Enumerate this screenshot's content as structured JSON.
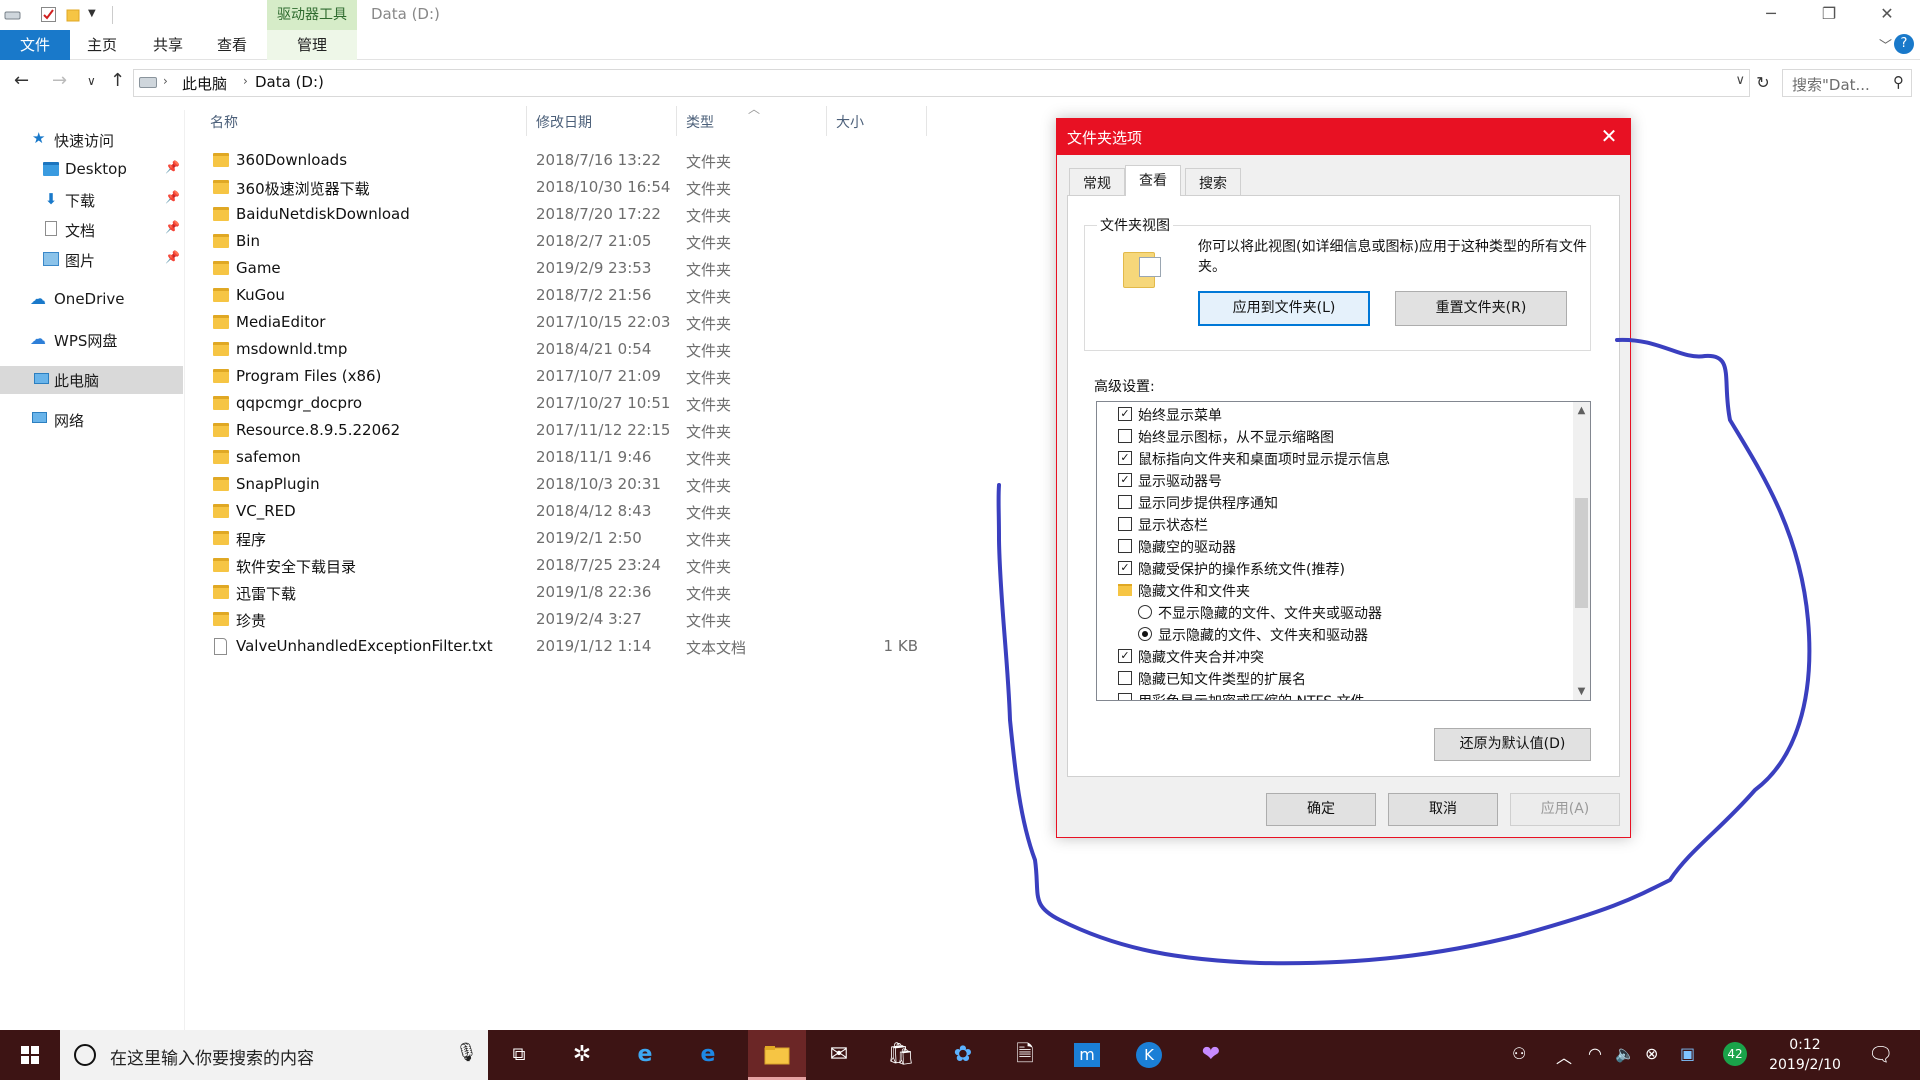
{
  "window": {
    "context_tab_group": "驱动器工具",
    "title": "Data (D:)",
    "ribbon_tabs": [
      "文件",
      "主页",
      "共享",
      "查看",
      "管理"
    ],
    "minimize": "─",
    "maximize": "❐",
    "close": "✕"
  },
  "address": {
    "segments": [
      "此电脑",
      "Data (D:)"
    ],
    "search_placeholder": "搜索\"Dat..."
  },
  "nav": {
    "quick_access": "快速访问",
    "quick_items": [
      "Desktop",
      "下载",
      "文档",
      "图片"
    ],
    "onedrive": "OneDrive",
    "wps": "WPS网盘",
    "this_pc": "此电脑",
    "network": "网络"
  },
  "columns": [
    "名称",
    "修改日期",
    "类型",
    "大小"
  ],
  "files": [
    {
      "name": "360Downloads",
      "date": "2018/7/16 13:22",
      "type": "文件夹",
      "size": ""
    },
    {
      "name": "360极速浏览器下载",
      "date": "2018/10/30 16:54",
      "type": "文件夹",
      "size": ""
    },
    {
      "name": "BaiduNetdiskDownload",
      "date": "2018/7/20 17:22",
      "type": "文件夹",
      "size": ""
    },
    {
      "name": "Bin",
      "date": "2018/2/7 21:05",
      "type": "文件夹",
      "size": ""
    },
    {
      "name": "Game",
      "date": "2019/2/9 23:53",
      "type": "文件夹",
      "size": ""
    },
    {
      "name": "KuGou",
      "date": "2018/7/2 21:56",
      "type": "文件夹",
      "size": ""
    },
    {
      "name": "MediaEditor",
      "date": "2017/10/15 22:03",
      "type": "文件夹",
      "size": ""
    },
    {
      "name": "msdownld.tmp",
      "date": "2018/4/21 0:54",
      "type": "文件夹",
      "size": ""
    },
    {
      "name": "Program Files (x86)",
      "date": "2017/10/7 21:09",
      "type": "文件夹",
      "size": ""
    },
    {
      "name": "qqpcmgr_docpro",
      "date": "2017/10/27 10:51",
      "type": "文件夹",
      "size": ""
    },
    {
      "name": "Resource.8.9.5.22062",
      "date": "2017/11/12 22:15",
      "type": "文件夹",
      "size": ""
    },
    {
      "name": "safemon",
      "date": "2018/11/1 9:46",
      "type": "文件夹",
      "size": ""
    },
    {
      "name": "SnapPlugin",
      "date": "2018/10/3 20:31",
      "type": "文件夹",
      "size": ""
    },
    {
      "name": "VC_RED",
      "date": "2018/4/12 8:43",
      "type": "文件夹",
      "size": ""
    },
    {
      "name": "程序",
      "date": "2019/2/1 2:50",
      "type": "文件夹",
      "size": ""
    },
    {
      "name": "软件安全下载目录",
      "date": "2018/7/25 23:24",
      "type": "文件夹",
      "size": ""
    },
    {
      "name": "迅雷下载",
      "date": "2019/1/8 22:36",
      "type": "文件夹",
      "size": ""
    },
    {
      "name": "珍贵",
      "date": "2019/2/4 3:27",
      "type": "文件夹",
      "size": ""
    },
    {
      "name": "ValveUnhandledExceptionFilter.txt",
      "date": "2019/1/12 1:14",
      "type": "文本文档",
      "size": "1 KB"
    }
  ],
  "dialog": {
    "title": "文件夹选项",
    "tabs": [
      "常规",
      "查看",
      "搜索"
    ],
    "active_tab": "查看",
    "folder_view_legend": "文件夹视图",
    "folder_view_text": "你可以将此视图(如详细信息或图标)应用于这种类型的所有文件夹。",
    "apply_to_folders": "应用到文件夹(L)",
    "reset_folders": "重置文件夹(R)",
    "advanced_label": "高级设置:",
    "settings": [
      {
        "kind": "checkbox",
        "checked": true,
        "label": "始终显示菜单"
      },
      {
        "kind": "checkbox",
        "checked": false,
        "label": "始终显示图标，从不显示缩略图"
      },
      {
        "kind": "checkbox",
        "checked": true,
        "label": "鼠标指向文件夹和桌面项时显示提示信息"
      },
      {
        "kind": "checkbox",
        "checked": true,
        "label": "显示驱动器号"
      },
      {
        "kind": "checkbox",
        "checked": false,
        "label": "显示同步提供程序通知"
      },
      {
        "kind": "checkbox",
        "checked": false,
        "label": "显示状态栏"
      },
      {
        "kind": "checkbox",
        "checked": false,
        "label": "隐藏空的驱动器"
      },
      {
        "kind": "checkbox",
        "checked": true,
        "label": "隐藏受保护的操作系统文件(推荐)"
      },
      {
        "kind": "folder",
        "checked": false,
        "label": "隐藏文件和文件夹"
      },
      {
        "kind": "radio",
        "checked": false,
        "label": "不显示隐藏的文件、文件夹或驱动器"
      },
      {
        "kind": "radio",
        "checked": true,
        "label": "显示隐藏的文件、文件夹和驱动器"
      },
      {
        "kind": "checkbox",
        "checked": true,
        "label": "隐藏文件夹合并冲突"
      },
      {
        "kind": "checkbox",
        "checked": false,
        "label": "隐藏已知文件类型的扩展名"
      },
      {
        "kind": "checkbox",
        "checked": false,
        "label": "用彩色显示加密或压缩的 NTFS 文件"
      }
    ],
    "restore_defaults": "还原为默认值(D)",
    "ok": "确定",
    "cancel": "取消",
    "apply": "应用(A)"
  },
  "taskbar": {
    "search_placeholder": "在这里输入你要搜索的内容",
    "badge": "42",
    "time": "0:12",
    "date": "2019/2/10"
  },
  "colors": {
    "accent": "#1979ca",
    "dialog_title": "#e81123",
    "taskbar": "#3d1414",
    "annotation": "#3a3fbf"
  }
}
